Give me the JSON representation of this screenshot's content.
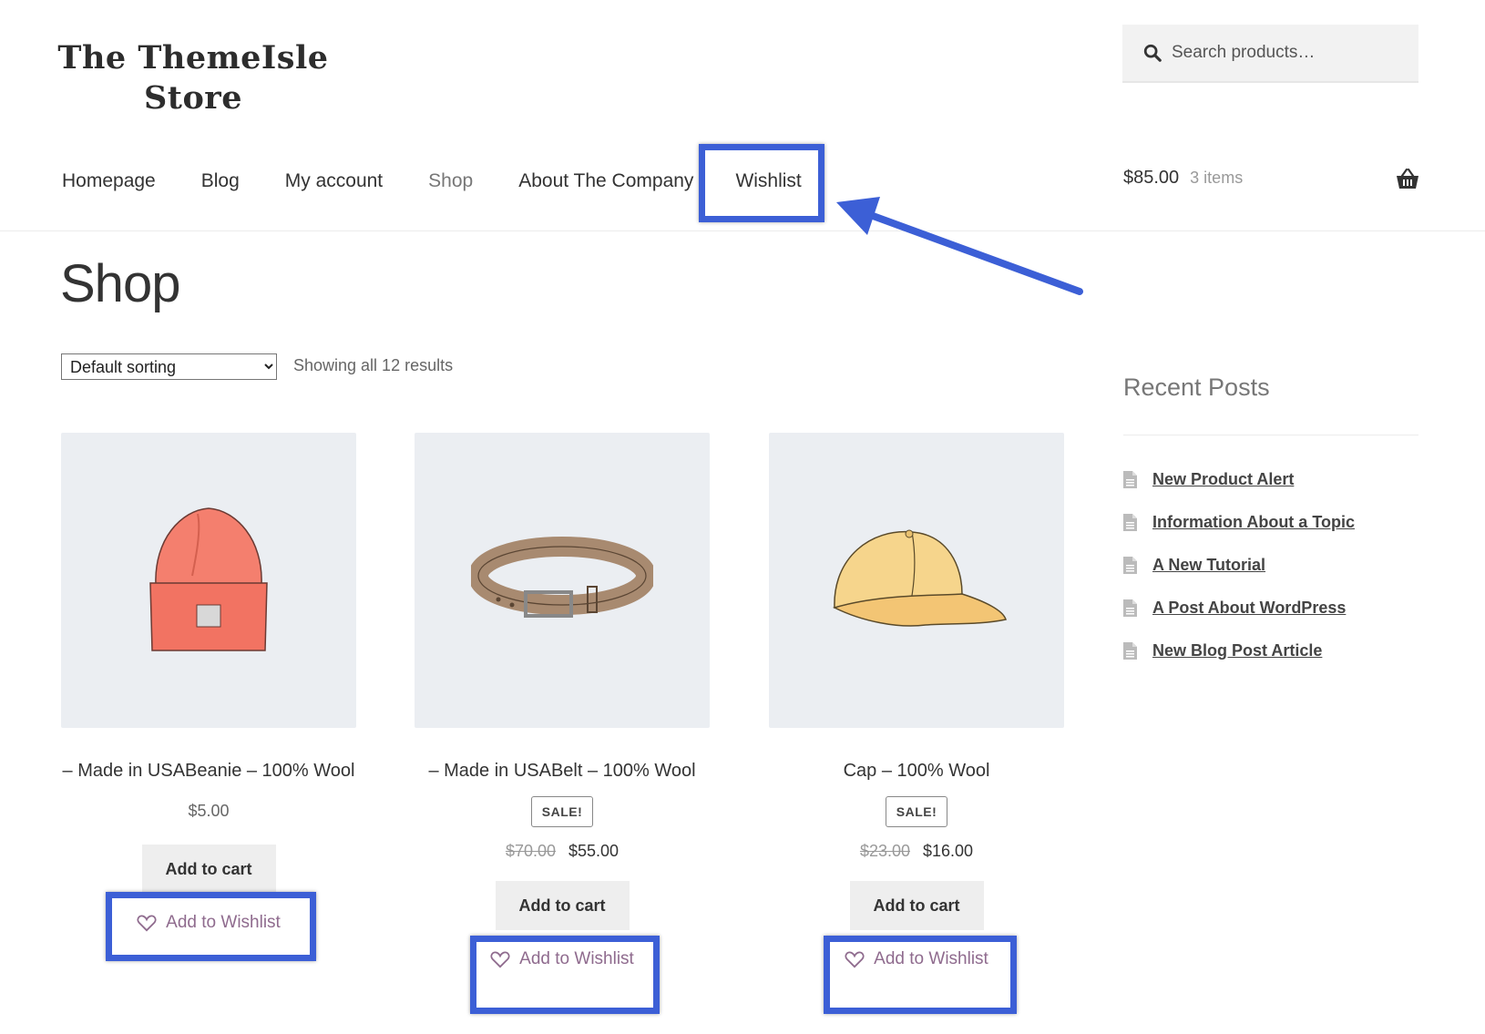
{
  "site": {
    "logo_line1": "The ThemeIsle",
    "logo_line2": "Store"
  },
  "search": {
    "placeholder": "Search products…"
  },
  "nav": {
    "items": [
      {
        "label": "Homepage"
      },
      {
        "label": "Blog"
      },
      {
        "label": "My account"
      },
      {
        "label": "Shop"
      },
      {
        "label": "About The Company"
      },
      {
        "label": "Wishlist"
      }
    ]
  },
  "cart": {
    "amount": "$85.00",
    "count": "3 items"
  },
  "page": {
    "title": "Shop",
    "sorting": "Default sorting",
    "results": "Showing all 12 results"
  },
  "products": [
    {
      "name": "– Made in USABeanie – 100% Wool",
      "price": "$5.00",
      "cart_label": "Add to cart",
      "wishlist_label": "Add to Wishlist"
    },
    {
      "name": "– Made in USABelt – 100% Wool",
      "sale": "SALE!",
      "old_price": "$70.00",
      "price": "$55.00",
      "cart_label": "Add to cart",
      "wishlist_label": "Add to Wishlist"
    },
    {
      "name": "Cap – 100% Wool",
      "sale": "SALE!",
      "old_price": "$23.00",
      "price": "$16.00",
      "cart_label": "Add to cart",
      "wishlist_label": "Add to Wishlist"
    }
  ],
  "sidebar": {
    "title": "Recent Posts",
    "posts": [
      {
        "label": "New Product Alert"
      },
      {
        "label": "Information About a Topic"
      },
      {
        "label": "A New Tutorial"
      },
      {
        "label": "A Post About WordPress"
      },
      {
        "label": "New Blog Post Article"
      }
    ]
  },
  "colors": {
    "highlight": "#3c5fd6",
    "wishlist_text": "#8f6b8e",
    "product_bg": "#ebeef2"
  }
}
